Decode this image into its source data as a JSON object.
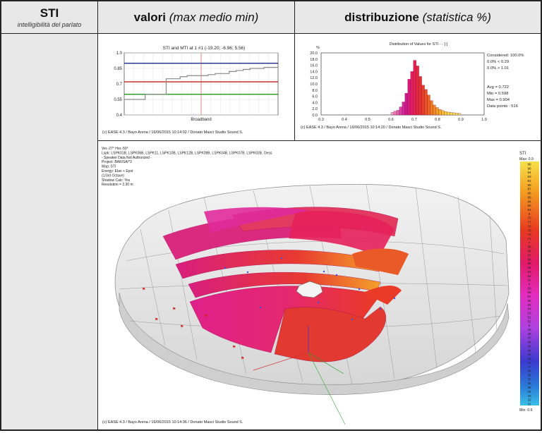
{
  "header": {
    "col1_title": "STI",
    "col1_subtitle": "intelligibilità del parlato",
    "col2_title": "valori",
    "col2_italic": "(max medio min)",
    "col3_title": "distribuzione",
    "col3_italic": "(statistica %)"
  },
  "line_panel": {
    "title": "STI and MTI at 1 #1  (-19.20; -6.96; 5.56)",
    "y_ticks": [
      "1.0",
      "0.85",
      "0.7",
      "0.55",
      "0.4"
    ],
    "x_label": "Broadband",
    "footer": "(c) EASE 4.3  / Bayo Arena  / 16/06/2015 10:14:02  / Donato Masci Studio Sound S.",
    "levels": {
      "max": 0.9,
      "avg": 0.72,
      "min": 0.6
    },
    "colors": {
      "max": "#1c2a8c",
      "avg": "#c02020",
      "min": "#1f9a1f",
      "curve": "#8a8a8a"
    }
  },
  "chart_data": {
    "type": "bar",
    "title": "Distribution of Values for STI  - - [-]",
    "ylabel": "%",
    "x_ticks": [
      "0.3",
      "0.4",
      "0.5",
      "0.6",
      "0.7",
      "0.8",
      "0.9",
      "1.0"
    ],
    "y_ticks": [
      "20.0",
      "18.0",
      "16.0",
      "14.0",
      "12.0",
      "10.0",
      "8.0",
      "6.0",
      "4.0",
      "2.0",
      "0.0"
    ],
    "xlim": [
      0.3,
      1.0
    ],
    "ylim": [
      0,
      20
    ],
    "bins": [
      0.6,
      0.612,
      0.624,
      0.636,
      0.648,
      0.66,
      0.672,
      0.684,
      0.696,
      0.708,
      0.72,
      0.732,
      0.744,
      0.756,
      0.768,
      0.78,
      0.792,
      0.804,
      0.816,
      0.828,
      0.84,
      0.852,
      0.864,
      0.876,
      0.888,
      0.9
    ],
    "values": [
      0.8,
      1.2,
      1.5,
      2.6,
      4.2,
      7.0,
      11.5,
      14.0,
      17.6,
      15.8,
      12.4,
      9.6,
      8.2,
      6.4,
      4.6,
      3.2,
      2.4,
      1.8,
      1.4,
      1.1,
      0.9,
      0.8,
      0.7,
      0.6,
      0.5
    ],
    "stats": {
      "considered": "Considered: 100.0%",
      "below": "0.0%  <  0.29",
      "above": "0.0%  >  1.01",
      "avg": "Avg = 0.722",
      "min": "Min = 0.598",
      "max": "Max = 0.904",
      "points": "Data points : 516"
    },
    "footer": "(c) EASE 4.3  / Bayo Arena  / 16/06/2015 10:14:20  / Donato Masci Studio Sound S."
  },
  "map_panel": {
    "info": [
      "Ver.-27°  Hor.-50°",
      "Lspk: LSPK01B, LSPK06B, LSPK11, LSPK10B, LSPK12B, LSPK09B, LSPK04B, LSPK07B, LSPK02B, Oess",
      "- Speaker Data Not Authorized -",
      "Project: BAR/SA/*3",
      "Map: STI",
      "Energy: Elan + Epst",
      "(1/3rd Octave)",
      "Shadow Calc: Yes",
      "Resolution =  2.30 m"
    ],
    "footer": "(c) EASE 4.3  / Bayo Arena  / 16/06/2015 10:14:36  / Donato Masci Studio Sound S.",
    "scale_title": "STI",
    "scale_max": "Max: 0.9",
    "scale_min": "Min: 0.6",
    "scale_labels": [
      "98",
      "96",
      "94",
      "93",
      "91",
      "89",
      "87",
      "86",
      "85",
      "84",
      "83",
      "81",
      "8",
      "79",
      "77",
      "76",
      "75",
      "73",
      "71",
      "7",
      "69",
      "68",
      "67",
      "66",
      "65",
      "64",
      "63",
      "62",
      "61",
      "6",
      "59",
      "58",
      "57",
      "56",
      "55",
      "54",
      "53",
      "52",
      "51",
      "5",
      "49",
      "48",
      "47",
      "46",
      "45",
      "44",
      "43",
      "42",
      "41",
      "4",
      "39",
      "38",
      "37",
      "36",
      "35",
      "34",
      "33",
      "32",
      "31"
    ]
  }
}
